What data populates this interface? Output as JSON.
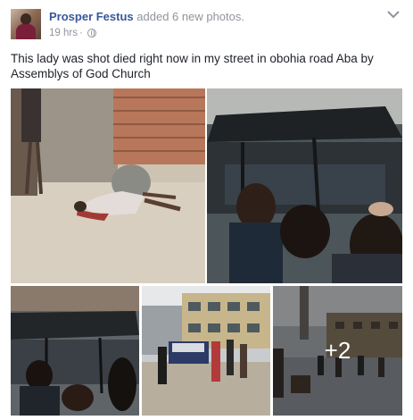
{
  "post": {
    "author": "Prosper Festus",
    "action": "added 6 new photos.",
    "time": "19 hrs",
    "time_separator": "·",
    "privacy_icon": "globe-icon",
    "options_icon": "chevron-down-icon",
    "caption": "This lady was shot died right now in my street in obohia road Aba by Assemblys of God Church"
  },
  "photos": {
    "more_count_label": "+2",
    "overlay_color": "#000000"
  },
  "colors": {
    "author_link": "#365899",
    "meta_text": "#90949c",
    "body_text": "#1d2129"
  }
}
